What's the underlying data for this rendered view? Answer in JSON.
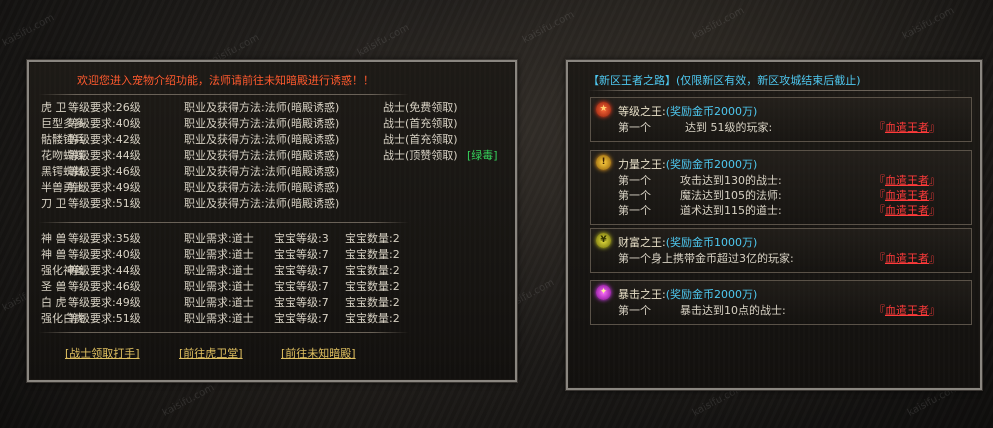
{
  "watermark": {
    "top_text": "开私服 kaisifu.com",
    "tile_text": "kaisifu.com"
  },
  "left_panel": {
    "header": "欢迎您进入宠物介绍功能，法师请前往未知暗殿进行诱惑！！",
    "pets": [
      {
        "name": "虎      卫",
        "req": "等级要求:26级",
        "method": "职业及获得方法:法师(暗殿诱惑)",
        "extra": "战士(免费领取)",
        "extra2": ""
      },
      {
        "name": "巨型多多",
        "req": "等级要求:40级",
        "method": "职业及获得方法:法师(暗殿诱惑)",
        "extra": "战士(首充领取)",
        "extra2": ""
      },
      {
        "name": "骷髅锤兵",
        "req": "等级要求:42级",
        "method": "职业及获得方法:法师(暗殿诱惑)",
        "extra": "战士(首充领取)",
        "extra2": ""
      },
      {
        "name": "花吻蝴蝶",
        "req": "等级要求:44级",
        "method": "职业及获得方法:法师(暗殿诱惑)",
        "extra": "战士(顶赞领取)",
        "extra2": "[绿毒]"
      },
      {
        "name": "黑锷蜘蛛",
        "req": "等级要求:46级",
        "method": "职业及获得方法:法师(暗殿诱惑)",
        "extra": "",
        "extra2": ""
      },
      {
        "name": "半兽勇士",
        "req": "等级要求:49级",
        "method": "职业及获得方法:法师(暗殿诱惑)",
        "extra": "",
        "extra2": ""
      },
      {
        "name": "刀      卫",
        "req": "等级要求:51级",
        "method": "职业及获得方法:法师(暗殿诱惑)",
        "extra": "",
        "extra2": ""
      }
    ],
    "beasts": [
      {
        "name": "神      兽",
        "req": "等级要求:35级",
        "job": "职业需求:道士",
        "lvl": "宝宝等级:3",
        "qty": "宝宝数量:2"
      },
      {
        "name": "神      兽",
        "req": "等级要求:40级",
        "job": "职业需求:道士",
        "lvl": "宝宝等级:7",
        "qty": "宝宝数量:2"
      },
      {
        "name": "强化神兽",
        "req": "等级要求:44级",
        "job": "职业需求:道士",
        "lvl": "宝宝等级:7",
        "qty": "宝宝数量:2"
      },
      {
        "name": "圣      兽",
        "req": "等级要求:46级",
        "job": "职业需求:道士",
        "lvl": "宝宝等级:7",
        "qty": "宝宝数量:2"
      },
      {
        "name": "白      虎",
        "req": "等级要求:49级",
        "job": "职业需求:道士",
        "lvl": "宝宝等级:7",
        "qty": "宝宝数量:2"
      },
      {
        "name": "强化白虎",
        "req": "等级要求:51级",
        "job": "职业需求:道士",
        "lvl": "宝宝等级:7",
        "qty": "宝宝数量:2"
      }
    ],
    "links": [
      "[战士领取打手]",
      "[前往虎卫堂]",
      "[前往未知暗殿]"
    ]
  },
  "right_panel": {
    "header": "【新区王者之路】(仅限新区有效，新区攻城结束后截止)",
    "sections": [
      {
        "badge": "★",
        "badge_color": "#c8301a",
        "title": "等级之王:",
        "reward": "(奖励金币2000万)",
        "rows": [
          {
            "rank": "第一个",
            "cond": "达到      51级的玩家:",
            "king_l": "『",
            "king": "血遣王者",
            "king_r": "』"
          }
        ]
      },
      {
        "badge": "!",
        "badge_color": "#e0a020",
        "title": "力量之王:",
        "reward": "(奖励金币2000万)",
        "rows": [
          {
            "rank": "第一个",
            "cond": "攻击达到130的战士:",
            "king_l": "『",
            "king": "血遣王者",
            "king_r": "』"
          },
          {
            "rank": "第一个",
            "cond": "魔法达到105的法师:",
            "king_l": "『",
            "king": "血遣王者",
            "king_r": "』"
          },
          {
            "rank": "第一个",
            "cond": "道术达到115的道士:",
            "king_l": "『",
            "king": "血遣王者",
            "king_r": "』"
          }
        ]
      },
      {
        "badge": "¥",
        "badge_color": "#c8c020",
        "title": "财富之王:",
        "reward": "(奖励金币1000万)",
        "rows": [
          {
            "rank": "第一个身上携带金币超过3亿的玩家:",
            "cond": "",
            "king_l": "『",
            "king": "血遣王者",
            "king_r": "』"
          }
        ]
      },
      {
        "badge": "✦",
        "badge_color": "#c040e0",
        "title": "暴击之王:",
        "reward": "(奖励金币2000万)",
        "rows": [
          {
            "rank": "第一个",
            "cond": "暴击达到10点的战士:",
            "king_l": "『",
            "king": "血遣王者",
            "king_r": "』"
          }
        ]
      }
    ]
  },
  "colors": {
    "header_red": "#ff5a2e",
    "cyan": "#4ec8f0",
    "link_gold": "#e0c060",
    "king_red": "#ff3a3a",
    "green": "#35d05a"
  }
}
